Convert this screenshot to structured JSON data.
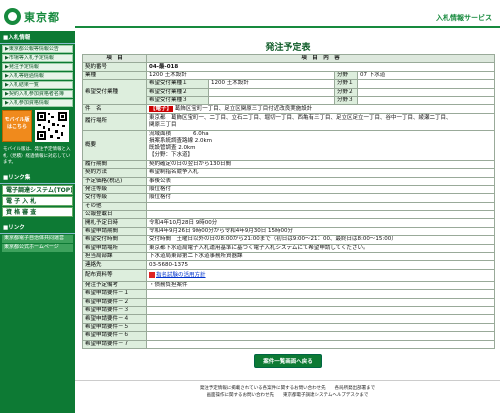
{
  "header": {
    "logo_text": "東京都",
    "service": "入札情報サービス"
  },
  "sidebar": {
    "section1": "■入札情報",
    "items1": [
      "▶東京都公報等情報公告",
      "▶市場等入札予定情報",
      "▶発注予定情報",
      "▶入札等経過情報",
      "▶入札結果一覧",
      "▶契約入札参加資格者名簿",
      "▶入札参加資格情報"
    ],
    "mobile_btn": "モバイル版はこちら",
    "mobile_text": "モバイル版は、発注予定情報と入札（見積）経過情報に対応しています。",
    "section2": "■リンク集",
    "items2": [
      "電子調達システム(TOP)",
      "電 子 入 札",
      "資 格 審 査"
    ],
    "section3": "■リンク",
    "items3": [
      "東京都電子自治体共同運営",
      "東京都公式ホームページ"
    ]
  },
  "page": {
    "title": "発注予定表",
    "col_item": "項　目",
    "col_content": "項　目　内　容"
  },
  "rows": {
    "contract_no": {
      "label": "契約番号",
      "value": "04-最-018"
    },
    "category": {
      "label": "業種",
      "value": "1200 土木設計",
      "bunya_label": "分野",
      "bunya_value": "07 下水道"
    },
    "desired": {
      "label": "希望受付業種",
      "r1l": "希望受付業種１",
      "r1v": "1200 土木設計",
      "r2l": "希望受付業種２",
      "r3l": "希望受付業種３",
      "b1": "分野１",
      "b2": "分野２",
      "b3": "分野３"
    },
    "name": {
      "label": "件　名",
      "tag": "【電子】",
      "value": "葛飾区宝町一丁目、足立区関原三丁目付近改良実施設計"
    },
    "place": {
      "label": "履行場所",
      "line1": "東京都　葛飾区宝町一、二丁目、立石二丁目、堀切一丁目、西亀有三丁目、足立区足立一丁目、谷中一丁目、綾瀬二丁目、",
      "line2": "関原三丁目"
    },
    "overview": {
      "label": "概要",
      "line1": "流域面積　　　　6.0ha",
      "line2": "損案系統調査路線 2.0km",
      "line3": "既設管調査 2.0km",
      "line4": "【分野：下水道】"
    },
    "period": {
      "label": "履行期間",
      "value": "契約確定の日の翌日から130日間"
    },
    "method": {
      "label": "契約方法",
      "value": "希望制指名競争入札"
    },
    "price": {
      "label": "予定価格(税込)",
      "value": "事後公表"
    },
    "dept": {
      "label": "発注等級",
      "value": "順位格付"
    },
    "accept": {
      "label": "受付等級",
      "value": "順位格付"
    },
    "other": {
      "label": "その他",
      "value": ""
    },
    "notice": {
      "label": "公報登載日",
      "value": ""
    },
    "open": {
      "label": "開札予定日時",
      "value": "令和4年10月28日 9時00分"
    },
    "apply_period": {
      "label": "希望申請期間",
      "value": "令和4年9月26日 9時00分から令和4年9月30日 15時00分"
    },
    "apply_time": {
      "label": "希望受付時間",
      "value": "受付時間　土曜日以外の日の8:00から21:00まで（初日は9:00～21：00、最終日は8:00～15:00）"
    },
    "apply_place": {
      "label": "希望申請場所",
      "value": "東京都下水道局電子入札運用基準に基づく電子入札システムにて希望申請してください。"
    },
    "office": {
      "label": "担当局部課",
      "value": "下水道局東部第二下水道事務所資器課"
    },
    "contact": {
      "label": "連絡先",
      "value": "03-5680-1375"
    },
    "docs": {
      "label": "配布資料等",
      "link": "指名試験の活用方針"
    },
    "remarks": {
      "label": "発注予定備考",
      "value": "・債務負担案件"
    },
    "req": [
      "希望申請要件－１",
      "希望申請要件－２",
      "希望申請要件－３",
      "希望申請要件－４",
      "希望申請要件－５",
      "希望申請要件－６",
      "希望申請要件－７"
    ]
  },
  "back_btn": "案件一覧画面へ戻る",
  "footer": {
    "line1": "発注予定情報に掲載されている各案件に関するお問い合わせ先　　各局所発出部署まで",
    "line2": "画面操作に関するお問い合わせ先　　東京都電子調達システムヘルプデスクまで"
  }
}
